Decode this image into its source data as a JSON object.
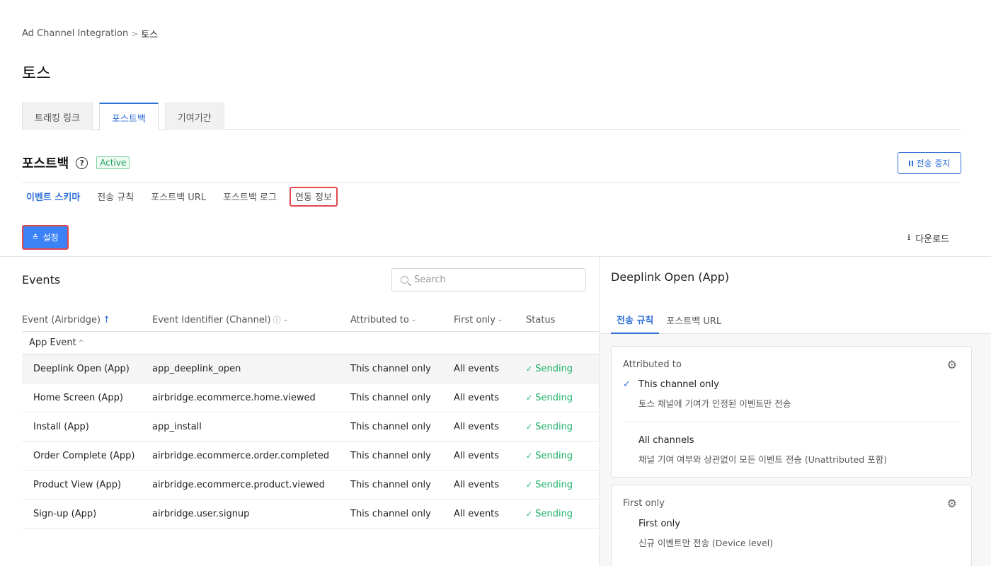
{
  "breadcrumb": {
    "parent": "Ad Channel Integration",
    "separator": ">",
    "current": "토스"
  },
  "page": {
    "title": "토스"
  },
  "top_tabs": [
    {
      "label": "트래킹 링크"
    },
    {
      "label": "포스트백"
    },
    {
      "label": "기여기간"
    }
  ],
  "section": {
    "title": "포스트백",
    "help": "?",
    "status": "Active",
    "stop_label": "전송 중지"
  },
  "sub_tabs": [
    {
      "label": "이벤트 스키마"
    },
    {
      "label": "전송 규칙"
    },
    {
      "label": "포스트백 URL"
    },
    {
      "label": "포스트백 로그"
    },
    {
      "label": "연동 정보"
    }
  ],
  "toolbar": {
    "settings_icon": "≛",
    "settings_label": "설정",
    "download_icon": "⭳",
    "download_label": "다운로드"
  },
  "events": {
    "title": "Events",
    "search_placeholder": "Search",
    "columns": {
      "event": "Event (Airbridge)",
      "identifier": "Event Identifier (Channel)",
      "attributed": "Attributed to",
      "first_only": "First only",
      "status": "Status"
    },
    "group": "App Event",
    "rows": [
      {
        "event": "Deeplink Open (App)",
        "identifier": "app_deeplink_open",
        "attributed": "This channel only",
        "first_only": "All events",
        "status": "Sending"
      },
      {
        "event": "Home Screen (App)",
        "identifier": "airbridge.ecommerce.home.viewed",
        "attributed": "This channel only",
        "first_only": "All events",
        "status": "Sending"
      },
      {
        "event": "Install (App)",
        "identifier": "app_install",
        "attributed": "This channel only",
        "first_only": "All events",
        "status": "Sending"
      },
      {
        "event": "Order Complete (App)",
        "identifier": "airbridge.ecommerce.order.completed",
        "attributed": "This channel only",
        "first_only": "All events",
        "status": "Sending"
      },
      {
        "event": "Product View (App)",
        "identifier": "airbridge.ecommerce.product.viewed",
        "attributed": "This channel only",
        "first_only": "All events",
        "status": "Sending"
      },
      {
        "event": "Sign-up (App)",
        "identifier": "airbridge.user.signup",
        "attributed": "This channel only",
        "first_only": "All events",
        "status": "Sending"
      }
    ]
  },
  "detail": {
    "title": "Deeplink Open (App)",
    "tabs": [
      {
        "label": "전송 규칙"
      },
      {
        "label": "포스트백 URL"
      }
    ],
    "attributed_card": {
      "label": "Attributed to",
      "options": [
        {
          "title": "This channel only",
          "desc": "토스 채널에 기여가 인정된 이벤트만 전송",
          "selected": true
        },
        {
          "title": "All channels",
          "desc": "채널 기여 여부와 상관없이 모든 이벤트 전송 (Unattributed 포함)",
          "selected": false
        }
      ]
    },
    "first_card": {
      "label": "First only",
      "options": [
        {
          "title": "First only",
          "desc": "신규 이벤트만 전송 (Device level)",
          "selected": false
        }
      ]
    }
  },
  "colors": {
    "accent": "#2f6fd6",
    "button_fill": "#3b82f6",
    "success": "#1fb26a",
    "highlight_border": "#e0474c"
  }
}
